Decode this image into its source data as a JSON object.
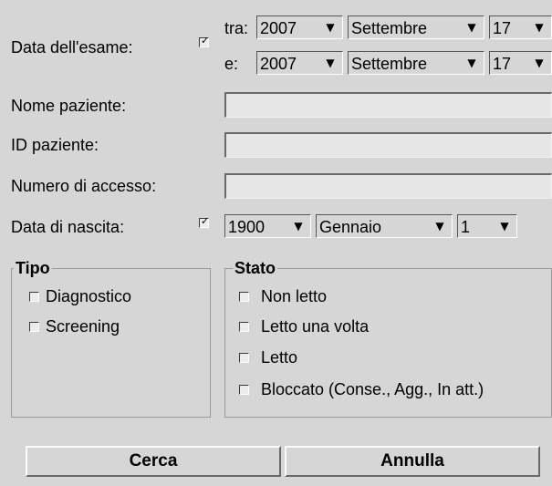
{
  "exam_date": {
    "label": "Data dell'esame:",
    "checked": true,
    "from_label": "tra:",
    "to_label": "e:",
    "from": {
      "year": "2007",
      "month": "Settembre",
      "day": "17"
    },
    "to": {
      "year": "2007",
      "month": "Settembre",
      "day": "17"
    }
  },
  "patient_name": {
    "label": "Nome paziente:",
    "value": ""
  },
  "patient_id": {
    "label": "ID paziente:",
    "value": ""
  },
  "accession_number": {
    "label": "Numero di accesso:",
    "value": ""
  },
  "birth_date": {
    "label": "Data di nascita:",
    "checked": true,
    "year": "1900",
    "month": "Gennaio",
    "day": "1"
  },
  "tipo": {
    "title": "Tipo",
    "options": [
      {
        "label": "Diagnostico",
        "checked": false
      },
      {
        "label": "Screening",
        "checked": false
      }
    ]
  },
  "stato": {
    "title": "Stato",
    "options": [
      {
        "label": "Non letto",
        "checked": false
      },
      {
        "label": "Letto una volta",
        "checked": false
      },
      {
        "label": "Letto",
        "checked": false
      },
      {
        "label": "Bloccato (Conse., Agg., In att.)",
        "checked": false
      }
    ]
  },
  "buttons": {
    "search": "Cerca",
    "cancel": "Annulla"
  },
  "icons": {
    "dropdown": "triangle-down-icon",
    "check": "check-icon"
  }
}
